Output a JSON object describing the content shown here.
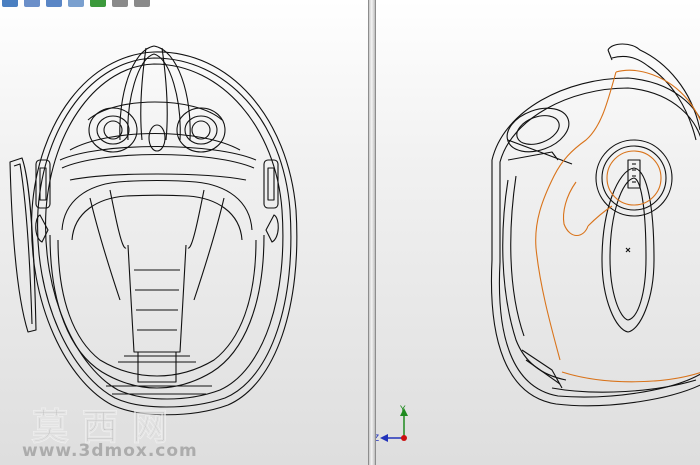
{
  "toolbar": {
    "buttons": [
      {
        "icon": "view-orientation-icon",
        "color": "#4a7fc1"
      },
      {
        "icon": "display-style-icon",
        "color": "#6b8fc9"
      },
      {
        "icon": "section-view-icon",
        "color": "#5a86c6"
      },
      {
        "icon": "hide-show-icon",
        "color": "#7aa0cf"
      },
      {
        "icon": "appearance-icon",
        "color": "#3c9a3c"
      },
      {
        "icon": "scene-icon",
        "color": "#8a8a8a"
      },
      {
        "icon": "view-settings-icon",
        "color": "#8a8a8a"
      }
    ]
  },
  "viewports": {
    "left": {
      "view": "helmet-front-wireframe"
    },
    "right": {
      "view": "helmet-side-wireframe"
    }
  },
  "triad": {
    "y_label": "Y",
    "z_label": "Z",
    "colors": {
      "y": "#1f8a1f",
      "z": "#2233bb",
      "origin": "#cc1111"
    }
  },
  "colors": {
    "wire": "#111111",
    "highlight": "#d9731a"
  },
  "watermark": {
    "brand": "莫西网",
    "url": "www.3dmox.com"
  }
}
